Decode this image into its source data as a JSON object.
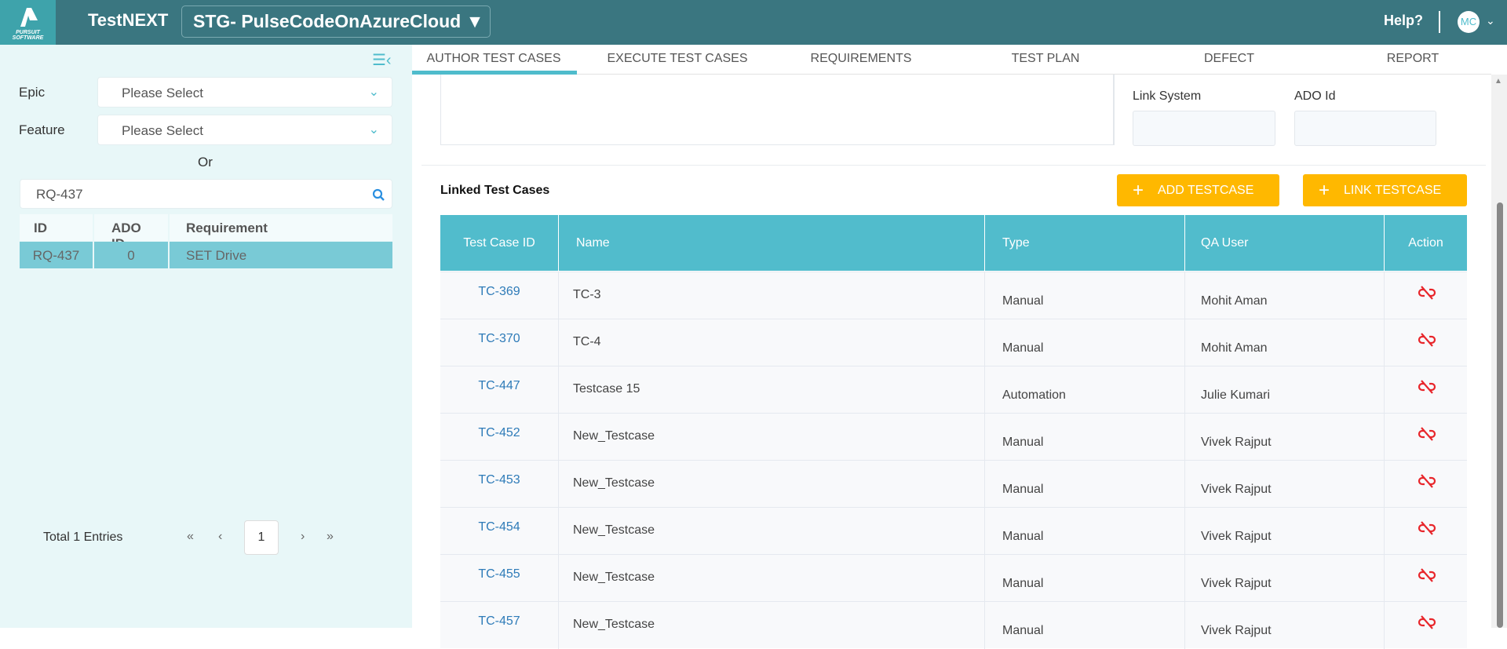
{
  "header": {
    "logo_text": "PURSUIT SOFTWARE",
    "app_title": "TestNEXT",
    "project": "STG- PulseCodeOnAzureCloud ▼",
    "help": "Help?",
    "avatar": "MC"
  },
  "sidebar": {
    "epic_label": "Epic",
    "epic_value": "Please Select",
    "feature_label": "Feature",
    "feature_value": "Please Select",
    "or": "Or",
    "search_value": "RQ-437",
    "columns": [
      "ID",
      "ADO ID",
      "Requirement"
    ],
    "rows": [
      {
        "id": "RQ-437",
        "ado": "0",
        "req": "SET Drive"
      }
    ],
    "total": "Total 1 Entries",
    "page": "1",
    "first": "«",
    "prev": "‹",
    "next": "›",
    "last": "»"
  },
  "tabs": [
    "AUTHOR TEST CASES",
    "EXECUTE TEST CASES",
    "REQUIREMENTS",
    "TEST PLAN",
    "DEFECT",
    "REPORT"
  ],
  "form": {
    "link_system": "Link System",
    "ado_id": "ADO Id"
  },
  "linked": {
    "title": "Linked Test Cases",
    "add": "ADD TESTCASE",
    "link": "LINK TESTCASE",
    "columns": [
      "Test Case ID",
      "Name",
      "Type",
      "QA User",
      "Action"
    ],
    "rows": [
      {
        "id": "TC-369",
        "name": "TC-3",
        "type": "Manual",
        "user": "Mohit Aman"
      },
      {
        "id": "TC-370",
        "name": "TC-4",
        "type": "Manual",
        "user": "Mohit Aman"
      },
      {
        "id": "TC-447",
        "name": "Testcase 15",
        "type": "Automation",
        "user": "Julie Kumari"
      },
      {
        "id": "TC-452",
        "name": "New_Testcase",
        "type": "Manual",
        "user": "Vivek Rajput"
      },
      {
        "id": "TC-453",
        "name": "New_Testcase",
        "type": "Manual",
        "user": "Vivek Rajput"
      },
      {
        "id": "TC-454",
        "name": "New_Testcase",
        "type": "Manual",
        "user": "Vivek Rajput"
      },
      {
        "id": "TC-455",
        "name": "New_Testcase",
        "type": "Manual",
        "user": "Vivek Rajput"
      },
      {
        "id": "TC-457",
        "name": "New_Testcase",
        "type": "Manual",
        "user": "Vivek Rajput"
      }
    ]
  },
  "colors": {
    "header": "#3a7680",
    "accent": "#51bccc",
    "button": "#ffb800",
    "unlink": "#e8262b",
    "link": "#2e7bb8"
  }
}
